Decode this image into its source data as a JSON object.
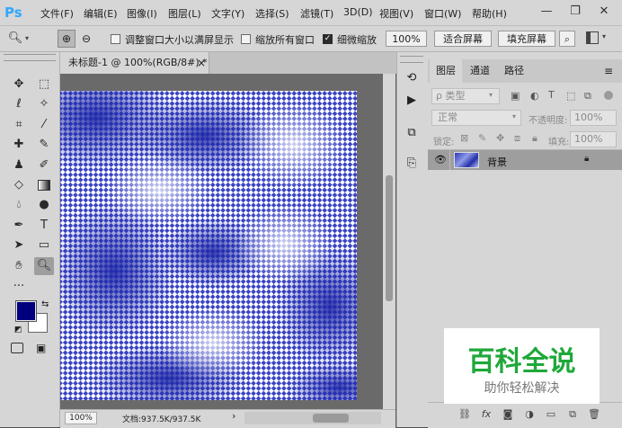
{
  "app": {
    "logo": "Ps"
  },
  "menu": [
    "文件(F)",
    "编辑(E)",
    "图像(I)",
    "图层(L)",
    "文字(Y)",
    "选择(S)",
    "滤镜(T)",
    "3D(D)",
    "视图(V)",
    "窗口(W)",
    "帮助(H)"
  ],
  "window_controls": {
    "minimize": "—",
    "restore": "❐",
    "close": "✕"
  },
  "options": {
    "resize_windows_label": "调整窗口大小以满屏显示",
    "zoom_all_label": "缩放所有窗口",
    "scrubby_zoom_label": "细微缩放",
    "scrubby_zoom_checked": true,
    "zoom_value": "100%",
    "fit_screen": "适合屏幕",
    "fill_screen": "填充屏幕"
  },
  "document": {
    "tab_title": "未标题-1 @ 100%(RGB/8#) *",
    "close": "×",
    "status_zoom": "100%",
    "status_doc": "文档:937.5K/937.5K",
    "status_arrow": "›"
  },
  "colors": {
    "foreground": "#00007f",
    "background": "#ffffff",
    "canvas_pattern": "#3a44c4"
  },
  "layers_panel": {
    "tabs": [
      "图层",
      "通道",
      "路径"
    ],
    "filter_label": "ρ 类型",
    "blend_mode": "正常",
    "opacity_label": "不透明度:",
    "opacity_value": "100%",
    "lock_label": "锁定:",
    "fill_label": "填充:",
    "fill_value": "100%",
    "layers": [
      {
        "name": "背景",
        "visible": true,
        "locked": true
      }
    ]
  },
  "watermark": {
    "title": "百科全说",
    "subtitle": "助你轻松解决"
  }
}
